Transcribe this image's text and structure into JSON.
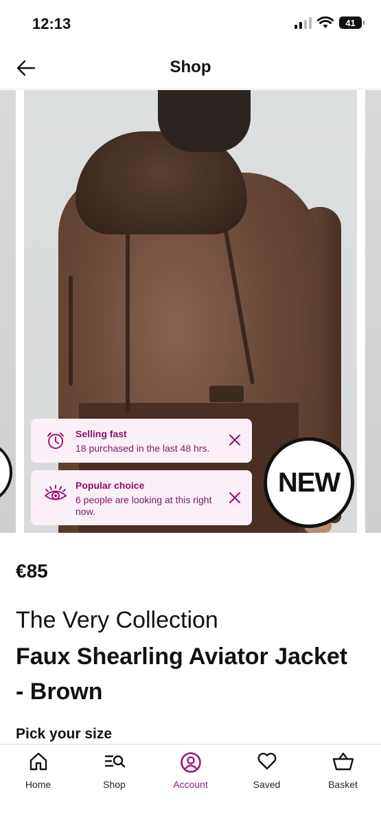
{
  "status_bar": {
    "time": "12:13",
    "battery": "41"
  },
  "header": {
    "title": "Shop",
    "back_icon": "arrow-left-icon"
  },
  "carousel": {
    "badge": "NEW",
    "notices": [
      {
        "icon": "alarm-clock-icon",
        "title": "Selling fast",
        "text": "18 purchased in the last 48 hrs."
      },
      {
        "icon": "eye-icon",
        "title": "Popular choice",
        "text": "6 people are looking at this right now."
      }
    ]
  },
  "product": {
    "price": "€85",
    "brand": "The Very Collection",
    "name": "Faux Shearling Aviator Jacket - Brown",
    "size_label": "Pick your size"
  },
  "bottom_nav": {
    "items": [
      {
        "label": "Home",
        "icon": "home-icon"
      },
      {
        "label": "Shop",
        "icon": "search-list-icon"
      },
      {
        "label": "Account",
        "icon": "account-icon",
        "active": true
      },
      {
        "label": "Saved",
        "icon": "heart-icon"
      },
      {
        "label": "Basket",
        "icon": "basket-icon"
      }
    ]
  },
  "colors": {
    "accent": "#a01476",
    "notice_bg": "#fcf0f8",
    "text": "#111111"
  }
}
